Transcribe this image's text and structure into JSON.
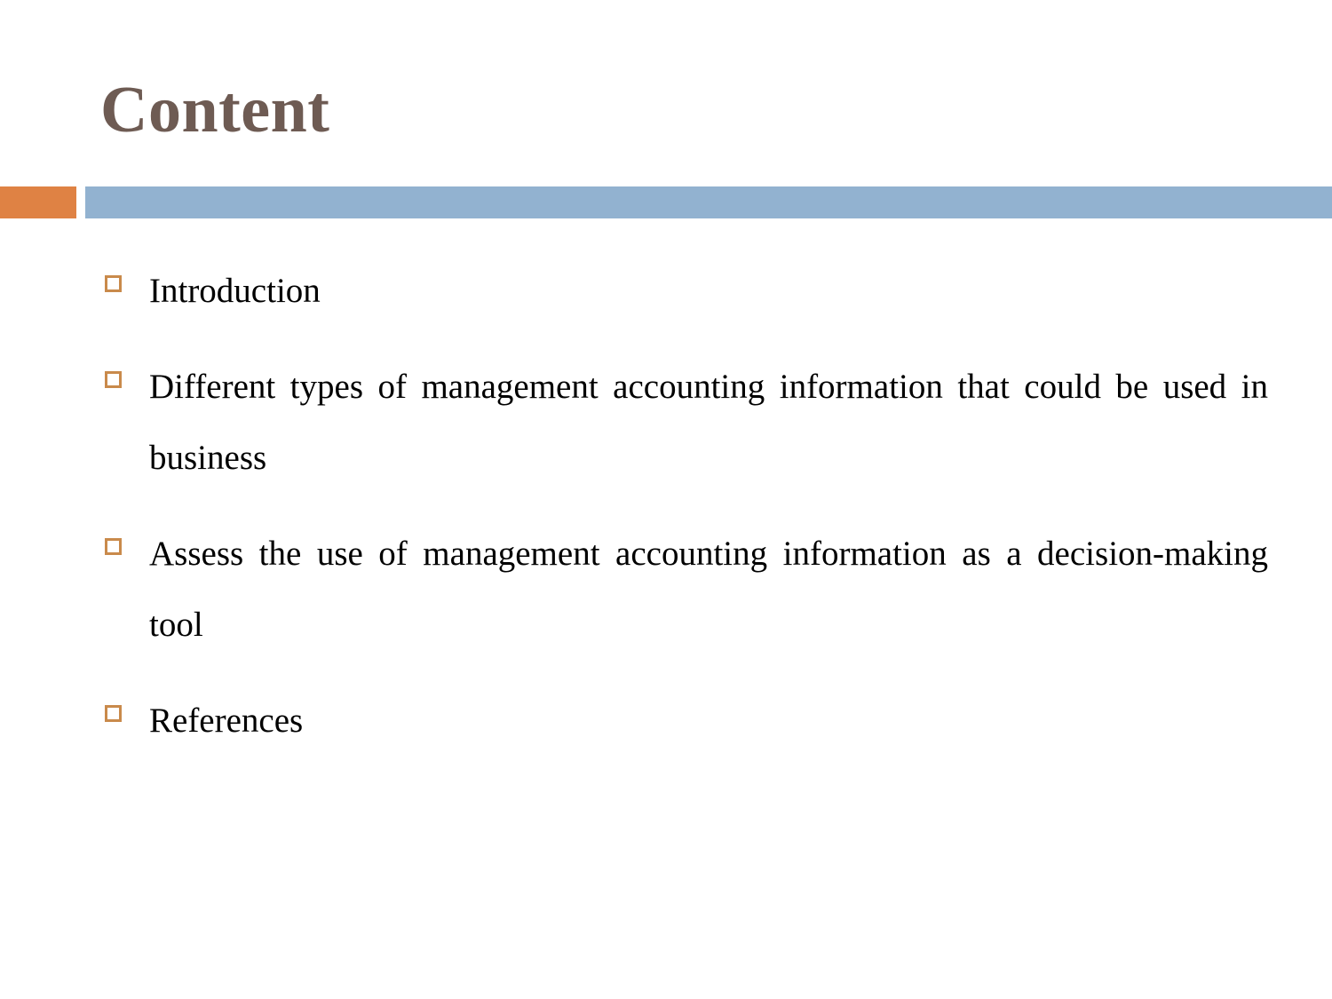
{
  "slide": {
    "title": "Content",
    "title_color": "#6E5B53",
    "background_color": "#FFFFFF"
  },
  "divider": {
    "accent_bar_color": "#DF8244",
    "main_bar_color": "#92B2D0"
  },
  "content": {
    "bullet_marker_color": "#C98A4B",
    "bullet_marker_glyph": "hollow-square",
    "items": [
      {
        "text": "Introduction"
      },
      {
        "text": "Different types of management accounting information that could be used in business"
      },
      {
        "text": "Assess the use of management accounting information as a decision-making tool"
      },
      {
        "text": "References"
      }
    ]
  }
}
